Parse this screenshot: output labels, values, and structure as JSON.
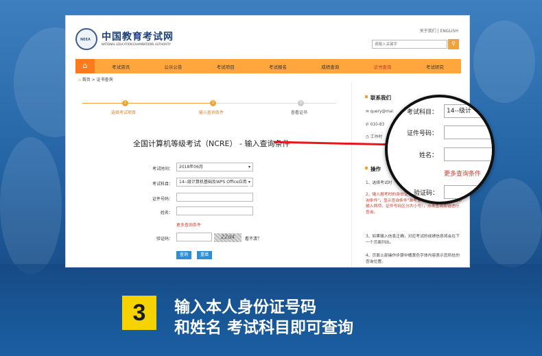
{
  "site": {
    "title": "中国教育考试网",
    "title_en": "NATIONAL EDUCATION EXAMINATIONS AUTHORITY",
    "logo_text": "NEEA",
    "top_links": "关于我们 | ENGLISH",
    "search_placeholder": "请输入关键字"
  },
  "nav": {
    "home_icon": "home-icon",
    "items": [
      "考试资讯",
      "公示公告",
      "考试项目",
      "考试报名",
      "成绩查询",
      "证书查询",
      "考试研究"
    ],
    "active": "证书查询"
  },
  "breadcrumb": "首页 > 证书查询",
  "steps": [
    {
      "num": "1",
      "label": "选择考试项目"
    },
    {
      "num": "2",
      "label": "输入查询条件"
    },
    {
      "num": "3",
      "label": "查看证书"
    }
  ],
  "form": {
    "title": "全国计算机等级考试（NCRE） - 输入查询条件",
    "exam_time_label": "考试时间：",
    "exam_time_value": "2018年06月",
    "subject_label": "考试科目：",
    "subject_value": "14--级计算机基础及WPS Office应用",
    "cert_label": "证件号码：",
    "name_label": "姓名：",
    "more_conditions": "更多查询条件",
    "captcha_label": "验证码：",
    "captcha_image_text": "22d4",
    "unclear": "看不清？",
    "query_btn": "查询",
    "reset_btn": "重填"
  },
  "sidebar": {
    "contact_title": "联系我们",
    "email": "query@mai",
    "phone": "010-83",
    "worktime": "工作时",
    "steps_title": "操作",
    "s1": "1、选择考试时",
    "s2": "2、输入报考时的身份证号码和姓名，可以点击\"更多查询条件\"，显示查询条件\"准考证号\"和\"证书编号\"，至少输入两项，证件号码区分大小写），点击查询按钮进行查询。",
    "s3": "3、如果输入信息正确，对应考试的成绩信息将会在下一个页面列出。",
    "s4": "4、页面上部操作步骤中橘黄色字体内容表示您所处的查询位置。"
  },
  "magnifier": {
    "subject_label": "考试科目：",
    "subject_value": "14--级计",
    "cert_label": "证件号码：",
    "name_label": "姓名：",
    "more": "更多查询条件",
    "captcha_label": "验证码："
  },
  "caption": {
    "step_number": "3",
    "line1": "输入本人身份证号码",
    "line2": "和姓名 考试科目即可查询"
  },
  "colors": {
    "accent": "#ffa73d",
    "badge": "#f5d300",
    "link_red": "#d43b2f",
    "button_blue": "#2d8fd5"
  }
}
